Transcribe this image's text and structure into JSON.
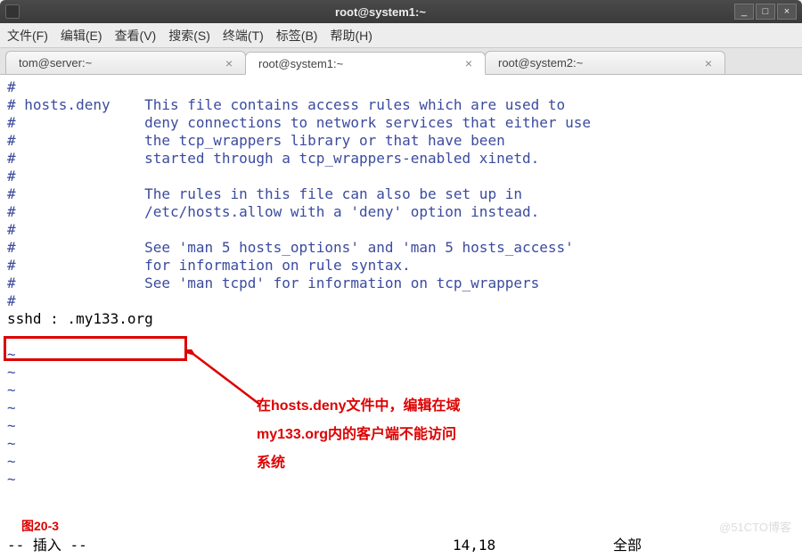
{
  "window": {
    "title": "root@system1:~",
    "controls": {
      "min": "_",
      "max": "□",
      "close": "×"
    }
  },
  "menu": {
    "file": "文件(F)",
    "edit": "编辑(E)",
    "view": "查看(V)",
    "search": "搜索(S)",
    "terminal": "终端(T)",
    "tabs": "标签(B)",
    "help": "帮助(H)"
  },
  "tabs": [
    {
      "label": "tom@server:~",
      "active": false
    },
    {
      "label": "root@system1:~",
      "active": true
    },
    {
      "label": "root@system2:~",
      "active": false
    }
  ],
  "content": {
    "l1": "#",
    "l2": "# hosts.deny    This file contains access rules which are used to",
    "l3": "#               deny connections to network services that either use",
    "l4": "#               the tcp_wrappers library or that have been",
    "l5": "#               started through a tcp_wrappers-enabled xinetd.",
    "l6": "#",
    "l7": "#               The rules in this file can also be set up in",
    "l8": "#               /etc/hosts.allow with a 'deny' option instead.",
    "l9": "#",
    "l10": "#               See 'man 5 hosts_options' and 'man 5 hosts_access'",
    "l11": "#               for information on rule syntax.",
    "l12": "#               See 'man tcpd' for information on tcp_wrappers",
    "l13": "#",
    "sshd": "sshd : .my133.org",
    "tilde": "~"
  },
  "annotation": {
    "line1": "在hosts.deny文件中，编辑在域",
    "line2": "my133.org内的客户端不能访问",
    "line3": "系统"
  },
  "figure": "图20-3",
  "status": {
    "mode": "-- 插入 --",
    "position": "14,18",
    "percent": "全部"
  },
  "watermark": "@51CTO博客"
}
